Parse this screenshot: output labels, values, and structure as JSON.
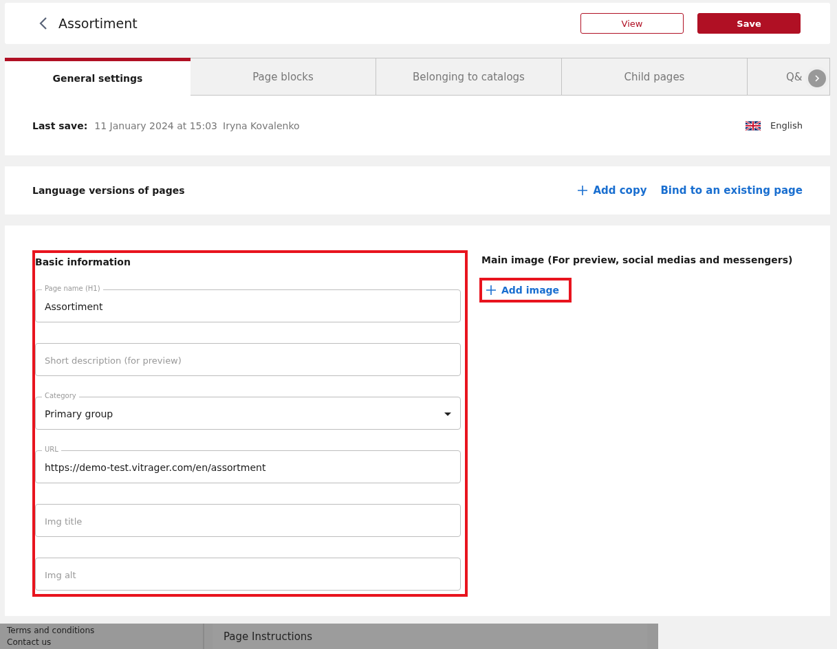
{
  "header": {
    "title": "Assortiment",
    "buttons": [
      {
        "label": "View",
        "kind": "outline"
      },
      {
        "label": "Save",
        "kind": "primary"
      }
    ]
  },
  "tabs": [
    {
      "label": "General settings",
      "selected": true
    },
    {
      "label": "Page blocks",
      "selected": false
    },
    {
      "label": "Belonging to catalogs",
      "selected": false
    },
    {
      "label": "Child pages",
      "selected": false
    },
    {
      "label": "Q&",
      "selected": false
    }
  ],
  "last_save": {
    "label": "Last save:",
    "date": "11 January 2024 at 15:03",
    "user": "Iryna Kovalenko",
    "language": "English"
  },
  "language_versions": {
    "title": "Language versions of pages",
    "actions": [
      {
        "label": "Add copy",
        "kind": "add"
      },
      {
        "label": "Bind to an existing page",
        "kind": "link"
      }
    ]
  },
  "basic_information": {
    "title": "Basic information",
    "highlighted": true,
    "fields": [
      {
        "kind": "text",
        "label": "Page name (H1)",
        "value": "Assortiment"
      },
      {
        "kind": "text",
        "placeholder": "Short description (for preview)"
      },
      {
        "kind": "select",
        "label": "Category",
        "value": "Primary group"
      },
      {
        "kind": "text",
        "label": "URL",
        "value": "https://demo-test.vitrager.com/en/assortment"
      },
      {
        "kind": "text",
        "placeholder": "Img title"
      },
      {
        "kind": "text",
        "placeholder": "Img alt"
      }
    ]
  },
  "main_image": {
    "title": "Main image (For preview, social medias and messengers)",
    "button": "Add image",
    "highlighted": true
  },
  "background": {
    "menu": [
      "Terms and conditions",
      "Contact us"
    ],
    "panel_title": "Page Instructions"
  }
}
